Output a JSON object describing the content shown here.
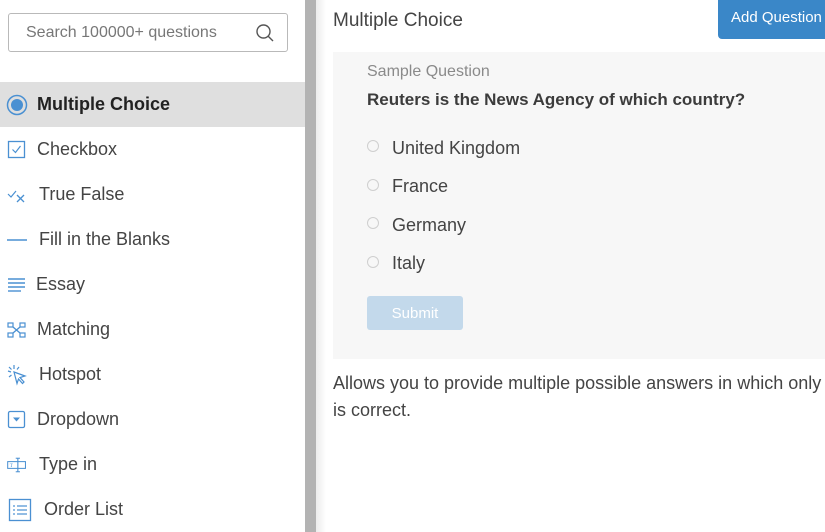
{
  "sidebar": {
    "search": {
      "placeholder": "Search 100000+ questions",
      "value": "",
      "icon": "search-icon"
    },
    "items": [
      {
        "label": "Multiple Choice",
        "icon": "radio-button-icon",
        "active": true
      },
      {
        "label": "Checkbox",
        "icon": "checkbox-icon",
        "active": false
      },
      {
        "label": "True False",
        "icon": "true-false-icon",
        "active": false
      },
      {
        "label": "Fill in the Blanks",
        "icon": "blank-line-icon",
        "active": false
      },
      {
        "label": "Essay",
        "icon": "text-lines-icon",
        "active": false
      },
      {
        "label": "Matching",
        "icon": "matching-icon",
        "active": false
      },
      {
        "label": "Hotspot",
        "icon": "cursor-click-icon",
        "active": false
      },
      {
        "label": "Dropdown",
        "icon": "dropdown-icon",
        "active": false
      },
      {
        "label": "Type in",
        "icon": "text-cursor-icon",
        "active": false
      },
      {
        "label": "Order List",
        "icon": "list-icon",
        "active": false
      }
    ]
  },
  "main": {
    "title": "Multiple Choice",
    "add_button_label": "Add Question",
    "sample": {
      "label": "Sample Question",
      "question": "Reuters is the News Agency of which country?",
      "options": [
        "United Kingdom",
        "France",
        "Germany",
        "Italy"
      ],
      "submit_label": "Submit"
    },
    "description_line1": "Allows you to provide multiple possible answers in which only",
    "description_line2": "is correct."
  },
  "colors": {
    "accent": "#3a87c8",
    "icon_blue": "#4a90d2",
    "submit_disabled": "#c3d9eb",
    "active_item_bg": "#dfdfdf",
    "card_bg": "#f7f7f7"
  }
}
